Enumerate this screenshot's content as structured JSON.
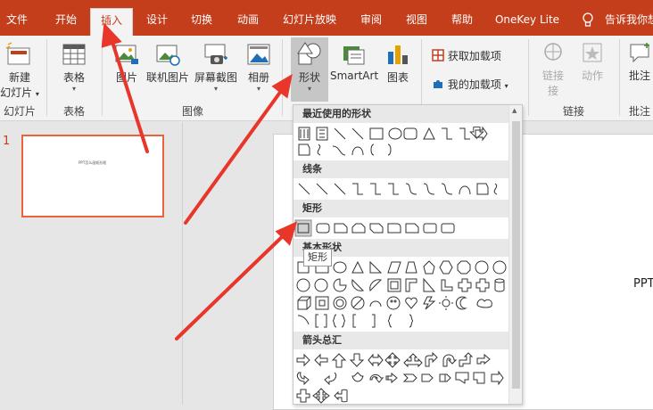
{
  "tabs": {
    "file": "文件",
    "home": "开始",
    "insert": "插入",
    "design": "设计",
    "transitions": "切换",
    "animations": "动画",
    "slideshow": "幻灯片放映",
    "review": "审阅",
    "view": "视图",
    "help": "帮助",
    "onekey": "OneKey Lite",
    "tellme": "告诉我你想"
  },
  "ribbon": {
    "new_slide_1": "新建",
    "new_slide_2": "幻灯片",
    "group_slides": "幻灯片",
    "table": "表格",
    "group_table": "表格",
    "picture": "图片",
    "online_picture": "联机图片",
    "screenshot": "屏幕截图",
    "album": "相册",
    "group_images": "图像",
    "shapes": "形状",
    "smartart": "SmartArt",
    "chart": "图表",
    "get_addins": "获取加载项",
    "my_addins": "我的加载项",
    "link": "链接",
    "link_2": "接",
    "action": "动作",
    "group_links": "链接",
    "comment": "批注",
    "group_comments": "批注"
  },
  "colors": {
    "accent": "#c43e1c",
    "selected_border": "#e8643a",
    "arrow": "#e8362a"
  },
  "thumbs": {
    "slide_number": "1",
    "thumb_text": "PPT怎么画矩形框"
  },
  "slide": {
    "text": "PPT"
  },
  "dropdown": {
    "recent": "最近使用的形状",
    "lines": "线条",
    "rect": "矩形",
    "basic": "基本形状",
    "arrows": "箭头总汇",
    "tooltip": "矩形"
  }
}
